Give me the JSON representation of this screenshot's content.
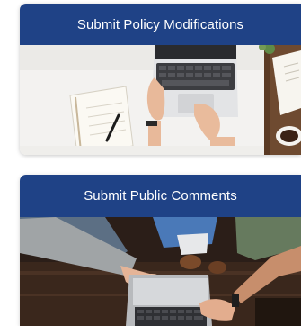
{
  "theme": {
    "header_color": "#1f4286",
    "header_text_color": "#ffffff"
  },
  "cards": [
    {
      "title": "Submit Policy Modifications",
      "image": "laptop-desk-notebook-photo"
    },
    {
      "title": "Submit Public Comments",
      "image": "group-hands-laptop-photo"
    }
  ]
}
